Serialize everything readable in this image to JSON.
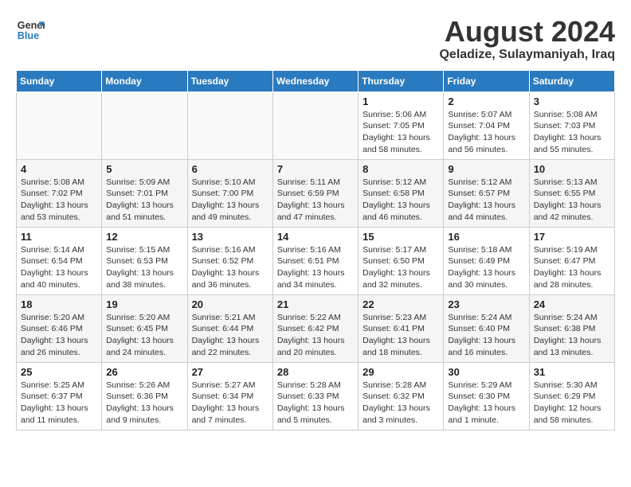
{
  "header": {
    "logo_line1": "General",
    "logo_line2": "Blue",
    "title": "August 2024",
    "subtitle": "Qeladize, Sulaymaniyah, Iraq"
  },
  "days_of_week": [
    "Sunday",
    "Monday",
    "Tuesday",
    "Wednesday",
    "Thursday",
    "Friday",
    "Saturday"
  ],
  "weeks": [
    [
      {
        "day": "",
        "info": ""
      },
      {
        "day": "",
        "info": ""
      },
      {
        "day": "",
        "info": ""
      },
      {
        "day": "",
        "info": ""
      },
      {
        "day": "1",
        "info": "Sunrise: 5:06 AM\nSunset: 7:05 PM\nDaylight: 13 hours\nand 58 minutes."
      },
      {
        "day": "2",
        "info": "Sunrise: 5:07 AM\nSunset: 7:04 PM\nDaylight: 13 hours\nand 56 minutes."
      },
      {
        "day": "3",
        "info": "Sunrise: 5:08 AM\nSunset: 7:03 PM\nDaylight: 13 hours\nand 55 minutes."
      }
    ],
    [
      {
        "day": "4",
        "info": "Sunrise: 5:08 AM\nSunset: 7:02 PM\nDaylight: 13 hours\nand 53 minutes."
      },
      {
        "day": "5",
        "info": "Sunrise: 5:09 AM\nSunset: 7:01 PM\nDaylight: 13 hours\nand 51 minutes."
      },
      {
        "day": "6",
        "info": "Sunrise: 5:10 AM\nSunset: 7:00 PM\nDaylight: 13 hours\nand 49 minutes."
      },
      {
        "day": "7",
        "info": "Sunrise: 5:11 AM\nSunset: 6:59 PM\nDaylight: 13 hours\nand 47 minutes."
      },
      {
        "day": "8",
        "info": "Sunrise: 5:12 AM\nSunset: 6:58 PM\nDaylight: 13 hours\nand 46 minutes."
      },
      {
        "day": "9",
        "info": "Sunrise: 5:12 AM\nSunset: 6:57 PM\nDaylight: 13 hours\nand 44 minutes."
      },
      {
        "day": "10",
        "info": "Sunrise: 5:13 AM\nSunset: 6:55 PM\nDaylight: 13 hours\nand 42 minutes."
      }
    ],
    [
      {
        "day": "11",
        "info": "Sunrise: 5:14 AM\nSunset: 6:54 PM\nDaylight: 13 hours\nand 40 minutes."
      },
      {
        "day": "12",
        "info": "Sunrise: 5:15 AM\nSunset: 6:53 PM\nDaylight: 13 hours\nand 38 minutes."
      },
      {
        "day": "13",
        "info": "Sunrise: 5:16 AM\nSunset: 6:52 PM\nDaylight: 13 hours\nand 36 minutes."
      },
      {
        "day": "14",
        "info": "Sunrise: 5:16 AM\nSunset: 6:51 PM\nDaylight: 13 hours\nand 34 minutes."
      },
      {
        "day": "15",
        "info": "Sunrise: 5:17 AM\nSunset: 6:50 PM\nDaylight: 13 hours\nand 32 minutes."
      },
      {
        "day": "16",
        "info": "Sunrise: 5:18 AM\nSunset: 6:49 PM\nDaylight: 13 hours\nand 30 minutes."
      },
      {
        "day": "17",
        "info": "Sunrise: 5:19 AM\nSunset: 6:47 PM\nDaylight: 13 hours\nand 28 minutes."
      }
    ],
    [
      {
        "day": "18",
        "info": "Sunrise: 5:20 AM\nSunset: 6:46 PM\nDaylight: 13 hours\nand 26 minutes."
      },
      {
        "day": "19",
        "info": "Sunrise: 5:20 AM\nSunset: 6:45 PM\nDaylight: 13 hours\nand 24 minutes."
      },
      {
        "day": "20",
        "info": "Sunrise: 5:21 AM\nSunset: 6:44 PM\nDaylight: 13 hours\nand 22 minutes."
      },
      {
        "day": "21",
        "info": "Sunrise: 5:22 AM\nSunset: 6:42 PM\nDaylight: 13 hours\nand 20 minutes."
      },
      {
        "day": "22",
        "info": "Sunrise: 5:23 AM\nSunset: 6:41 PM\nDaylight: 13 hours\nand 18 minutes."
      },
      {
        "day": "23",
        "info": "Sunrise: 5:24 AM\nSunset: 6:40 PM\nDaylight: 13 hours\nand 16 minutes."
      },
      {
        "day": "24",
        "info": "Sunrise: 5:24 AM\nSunset: 6:38 PM\nDaylight: 13 hours\nand 13 minutes."
      }
    ],
    [
      {
        "day": "25",
        "info": "Sunrise: 5:25 AM\nSunset: 6:37 PM\nDaylight: 13 hours\nand 11 minutes."
      },
      {
        "day": "26",
        "info": "Sunrise: 5:26 AM\nSunset: 6:36 PM\nDaylight: 13 hours\nand 9 minutes."
      },
      {
        "day": "27",
        "info": "Sunrise: 5:27 AM\nSunset: 6:34 PM\nDaylight: 13 hours\nand 7 minutes."
      },
      {
        "day": "28",
        "info": "Sunrise: 5:28 AM\nSunset: 6:33 PM\nDaylight: 13 hours\nand 5 minutes."
      },
      {
        "day": "29",
        "info": "Sunrise: 5:28 AM\nSunset: 6:32 PM\nDaylight: 13 hours\nand 3 minutes."
      },
      {
        "day": "30",
        "info": "Sunrise: 5:29 AM\nSunset: 6:30 PM\nDaylight: 13 hours\nand 1 minute."
      },
      {
        "day": "31",
        "info": "Sunrise: 5:30 AM\nSunset: 6:29 PM\nDaylight: 12 hours\nand 58 minutes."
      }
    ]
  ]
}
